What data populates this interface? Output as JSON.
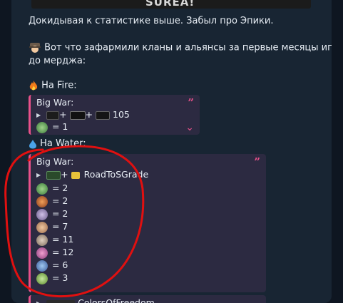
{
  "banner": {
    "text": "SUREA!"
  },
  "message": {
    "line1": "Докидывая к статистике выше. Забыл про Эпики.",
    "line2": "Вот что зафармили кланы и альянсы за первые месяцы игры",
    "line3": "до мерджа:"
  },
  "fire": {
    "heading": "На Fire:",
    "quote": {
      "title": "Big War:",
      "row1": "105",
      "row2": "= 1"
    }
  },
  "water": {
    "heading": "На Water:",
    "quote": {
      "title": "Big War:",
      "row1": "RoadToSGrade",
      "counts": [
        "= 2",
        "= 2",
        "= 2",
        "= 7",
        "= 11",
        "= 12",
        "= 6",
        "= 3"
      ]
    },
    "next_row": "ColorsOfFreedom"
  },
  "colors": {
    "accent": "#e8518a",
    "quote_bg": "#2c2a41",
    "bubble_bg": "#182533",
    "annotation": "#e01010"
  },
  "icons": [
    "fire-emoji-icon",
    "droplet-emoji-icon",
    "detective-emoji-icon",
    "quote-icon",
    "expand-chevron-icon",
    "crown-icon",
    "epic-item-icon"
  ]
}
